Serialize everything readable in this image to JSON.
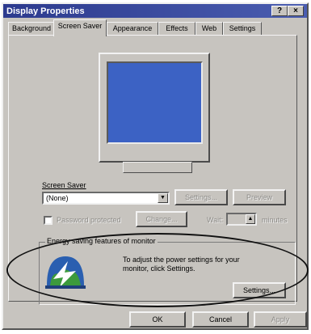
{
  "window": {
    "title": "Display Properties",
    "controls": "?|X"
  },
  "tabs": [
    {
      "label": "Background",
      "active": false
    },
    {
      "label": "Screen Saver",
      "active": true
    },
    {
      "label": "Appearance",
      "active": false
    },
    {
      "label": "Effects",
      "active": false
    },
    {
      "label": "Web",
      "active": false
    },
    {
      "label": "Settings",
      "active": false
    }
  ],
  "screen_saver": {
    "label": "Screen Saver",
    "value": "(None)",
    "settings_button": "Settings...",
    "preview_button": "Preview",
    "password_label": "Password protected",
    "change_button": "Change...",
    "wait_label": "Wait:",
    "wait_unit": "minutes"
  },
  "energy": {
    "group_title": "Energy saving features of monitor",
    "description": "To adjust the power settings for your monitor, click Settings.",
    "settings_button": "Settings..."
  },
  "footer": {
    "ok": "OK",
    "cancel": "Cancel",
    "apply": "Apply"
  },
  "colors": {
    "dialog": "#c7c4bf",
    "titlebar": "#2c3a8e",
    "monitor_screen": "#3c62c4"
  }
}
